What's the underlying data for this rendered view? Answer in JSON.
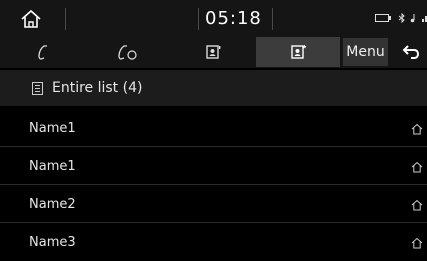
{
  "status_bar": {
    "time": "05:18"
  },
  "tabs": [
    {
      "icon": "phone-icon",
      "active": false
    },
    {
      "icon": "recent-calls-icon",
      "active": false
    },
    {
      "icon": "contacts-icon",
      "active": false
    },
    {
      "icon": "favorites-contacts-icon",
      "active": true
    }
  ],
  "menu_label": "Menu",
  "list_header": {
    "title": "Entire list (4)"
  },
  "list": [
    {
      "name": "Name1"
    },
    {
      "name": "Name1"
    },
    {
      "name": "Name2"
    },
    {
      "name": "Name3"
    }
  ],
  "colors": {
    "background": "#000000",
    "bar": "#151515",
    "active_tab": "#3c3c3c",
    "text": "#e6e6e6"
  }
}
